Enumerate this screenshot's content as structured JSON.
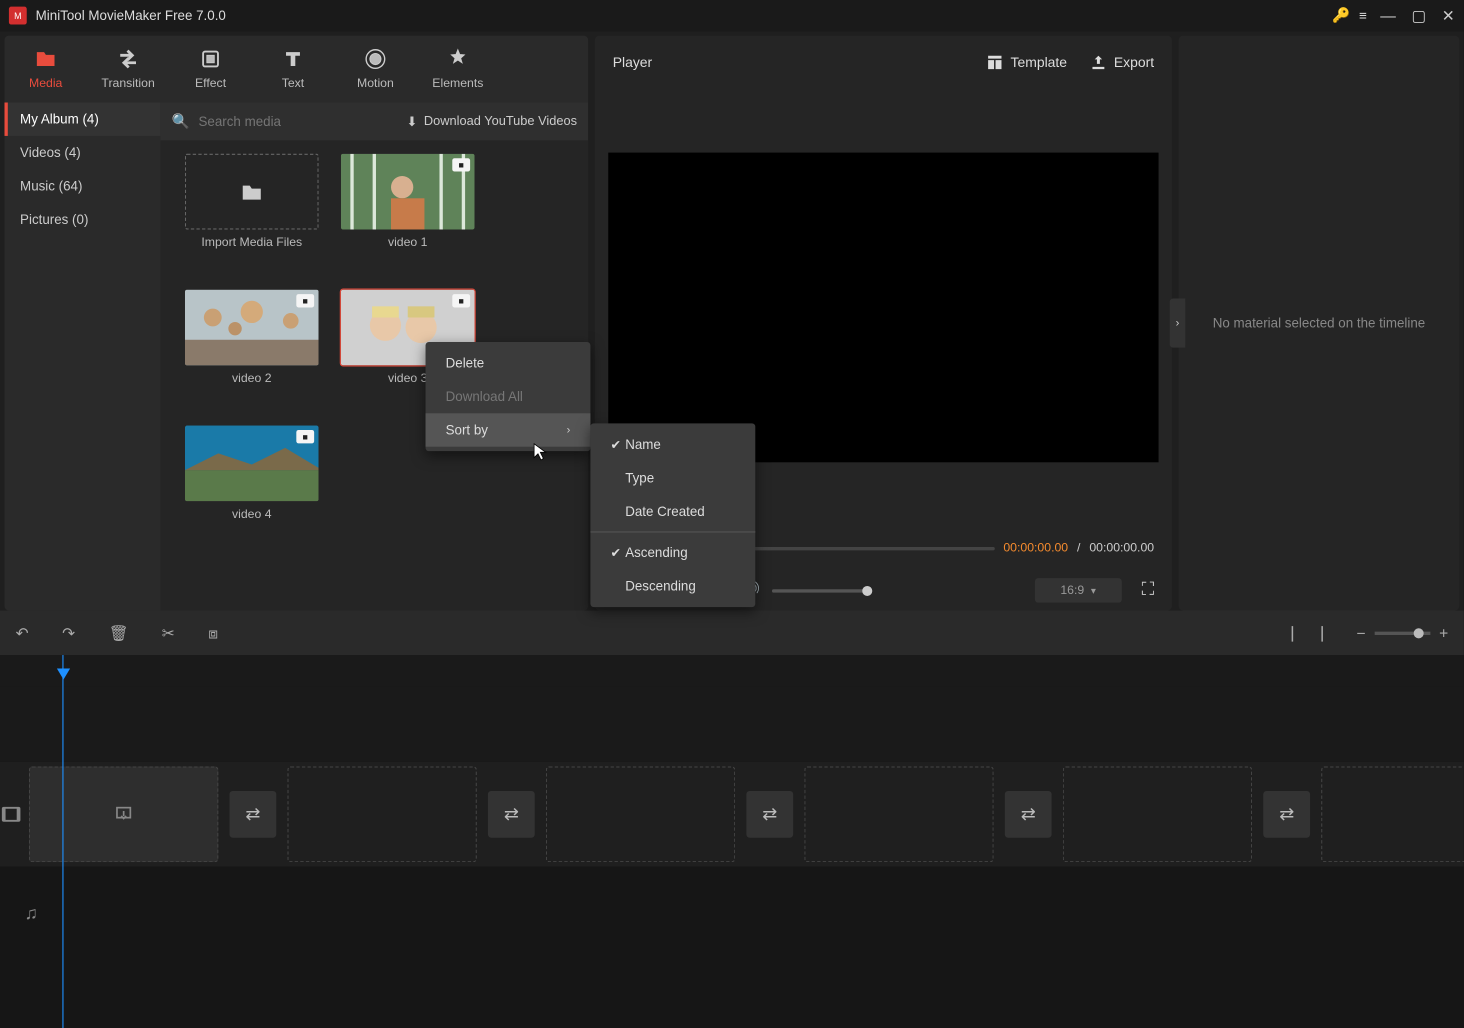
{
  "app": {
    "title": "MiniTool MovieMaker Free 7.0.0"
  },
  "tabs": {
    "media": "Media",
    "transition": "Transition",
    "effect": "Effect",
    "text": "Text",
    "motion": "Motion",
    "elements": "Elements"
  },
  "sidebar": {
    "my_album": "My Album (4)",
    "videos": "Videos (4)",
    "music": "Music (64)",
    "pictures": "Pictures (0)"
  },
  "search": {
    "placeholder": "Search media"
  },
  "download_yt": "Download YouTube Videos",
  "media": {
    "import": "Import Media Files",
    "v1": "video 1",
    "v2": "video 2",
    "v3": "video 3",
    "v4": "video 4"
  },
  "ctx": {
    "delete": "Delete",
    "download_all": "Download All",
    "sort_by": "Sort by"
  },
  "sort": {
    "name": "Name",
    "type": "Type",
    "date": "Date Created",
    "asc": "Ascending",
    "desc": "Descending"
  },
  "player": {
    "label": "Player",
    "template": "Template",
    "export": "Export",
    "time_cur": "00:00:00.00",
    "time_sep": "/",
    "time_total": "00:00:00.00",
    "aspect": "16:9"
  },
  "sidepanel": {
    "msg": "No material selected on the timeline"
  }
}
